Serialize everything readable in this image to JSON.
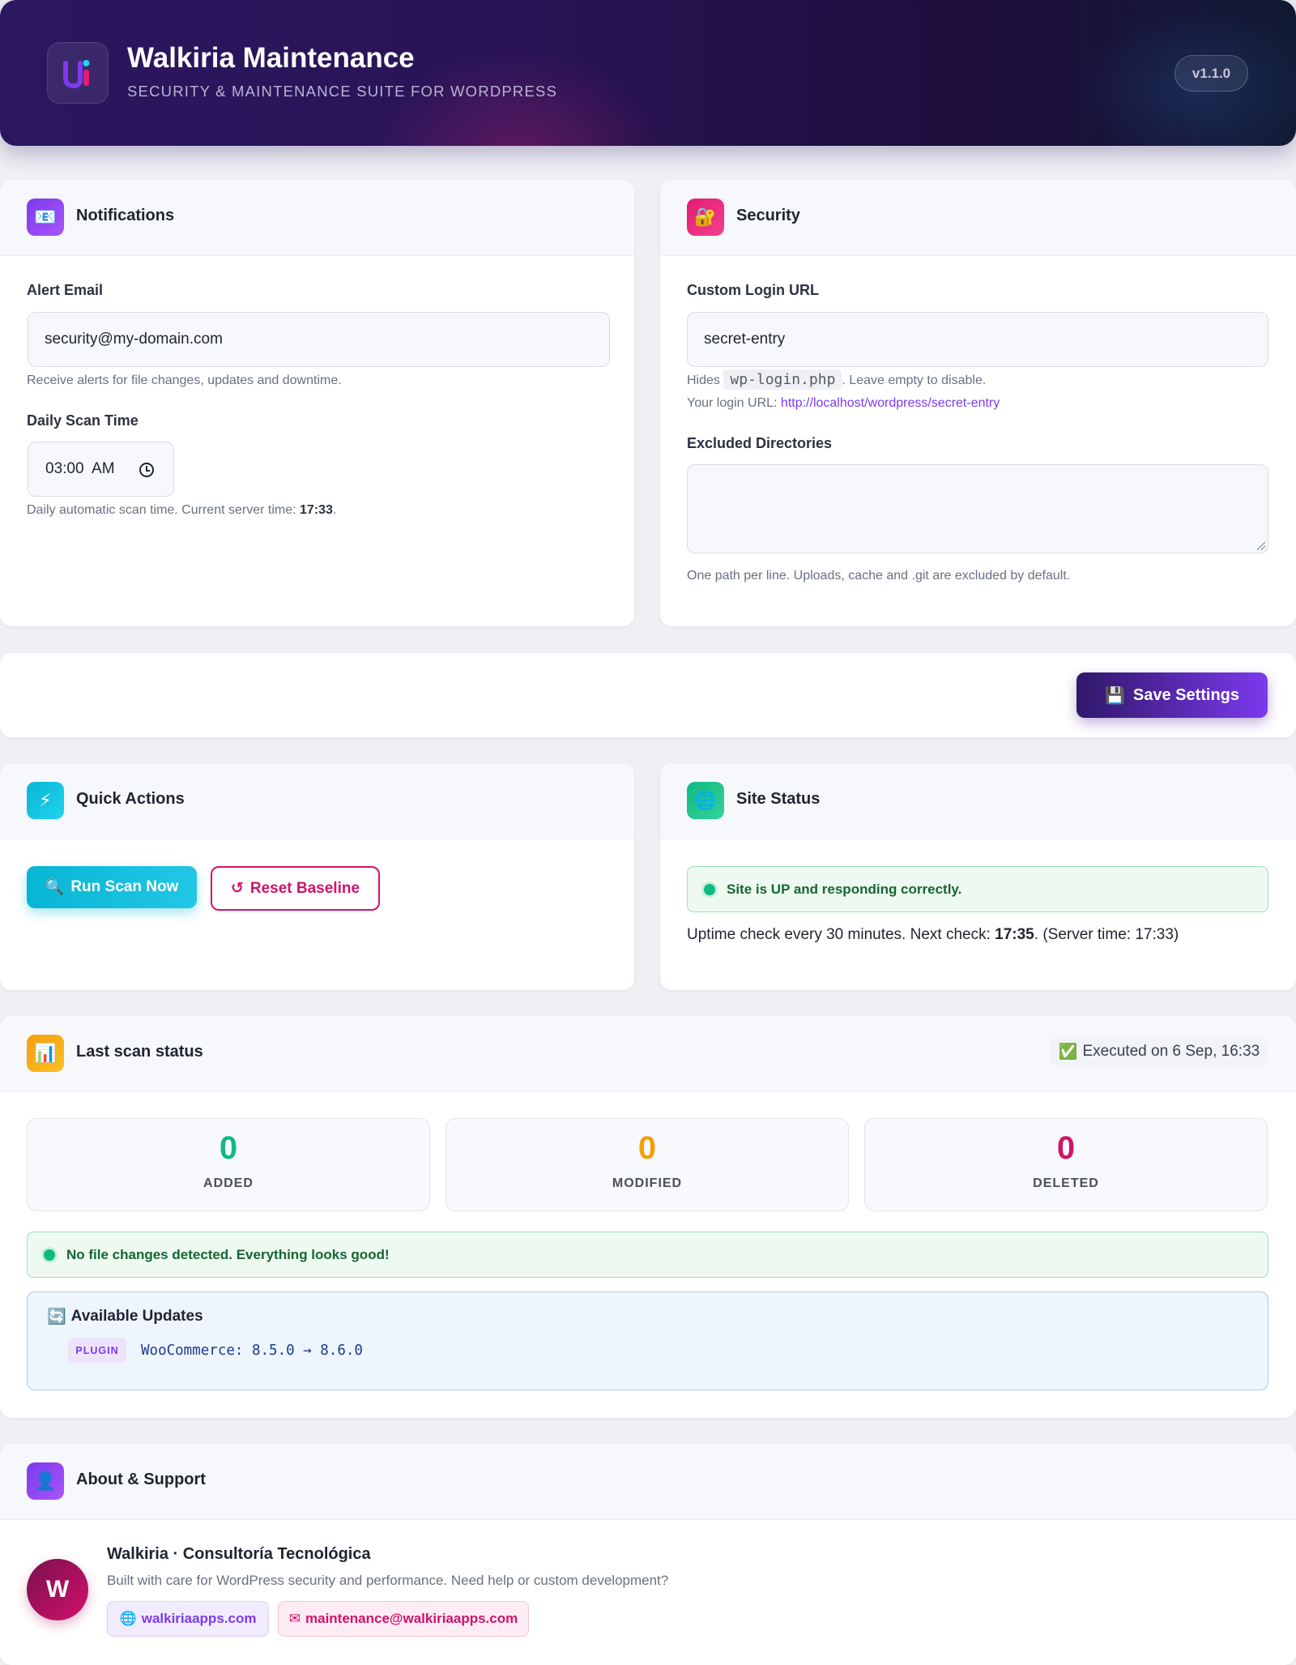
{
  "header": {
    "title": "Walkiria Maintenance",
    "subtitle": "SECURITY & MAINTENANCE SUITE FOR WORDPRESS",
    "version": "v1.1.0"
  },
  "notifications": {
    "icon": "📧",
    "title": "Notifications",
    "alert_email_label": "Alert Email",
    "alert_email_value": "security@my-domain.com",
    "alert_email_help": "Receive alerts for file changes, updates and downtime.",
    "scan_time_label": "Daily Scan Time",
    "scan_time_value": "03:00  AM",
    "scan_time_help_prefix": "Daily automatic scan time. Current server time: ",
    "server_time": "17:33",
    "scan_time_help_suffix": "."
  },
  "security": {
    "icon": "🔐",
    "title": "Security",
    "login_url_label": "Custom Login URL",
    "login_url_value": "secret-entry",
    "hides_prefix": "Hides ",
    "hides_code": "wp-login.php",
    "hides_suffix": ". Leave empty to disable.",
    "login_url_prefix": "Your login URL: ",
    "login_url_link": "http://localhost/wordpress/secret-entry",
    "excluded_label": "Excluded Directories",
    "excluded_value": "",
    "excluded_help": "One path per line. Uploads, cache and .git are excluded by default."
  },
  "save": {
    "icon": "💾",
    "label": "Save Settings"
  },
  "quick_actions": {
    "icon": "⚡",
    "title": "Quick Actions",
    "scan_icon": "🔍",
    "scan_label": "Run Scan Now",
    "reset_icon": "↺",
    "reset_label": "Reset Baseline"
  },
  "site_status": {
    "icon": "🌐",
    "title": "Site Status",
    "status_message": "Site is UP and responding correctly.",
    "uptime_prefix": "Uptime check every 30 minutes. Next check: ",
    "next_check": "17:35",
    "uptime_suffix": ". (Server time: 17:33)"
  },
  "last_scan": {
    "icon": "📊",
    "title": "Last scan status",
    "executed_icon": "✅",
    "executed_text": "Executed on 6 Sep, 16:33",
    "stats": [
      {
        "value": "0",
        "label": "ADDED",
        "color": "#10b981"
      },
      {
        "value": "0",
        "label": "MODIFIED",
        "color": "#f59e0b"
      },
      {
        "value": "0",
        "label": "DELETED",
        "color": "#d1126b"
      }
    ],
    "ok_message": "No file changes detected. Everything looks good!",
    "updates_icon": "🔄",
    "updates_title": "Available Updates",
    "updates": [
      {
        "type": "PLUGIN",
        "text": "WooCommerce: 8.5.0 → 8.6.0"
      }
    ]
  },
  "about": {
    "icon": "👤",
    "title": "About & Support",
    "avatar_letter": "W",
    "company": "Walkiria · Consultoría Tecnológica",
    "description": "Built with care for WordPress security and performance. Need help or custom development?",
    "site_icon": "🌐",
    "site_label": "walkiriaapps.com",
    "mail_icon": "✉",
    "mail_label": "maintenance@walkiriaapps.com"
  },
  "colors": {
    "primary": "#7c3aed",
    "accent_pink": "#d1126b",
    "success": "#10b981",
    "warning": "#f59e0b"
  }
}
